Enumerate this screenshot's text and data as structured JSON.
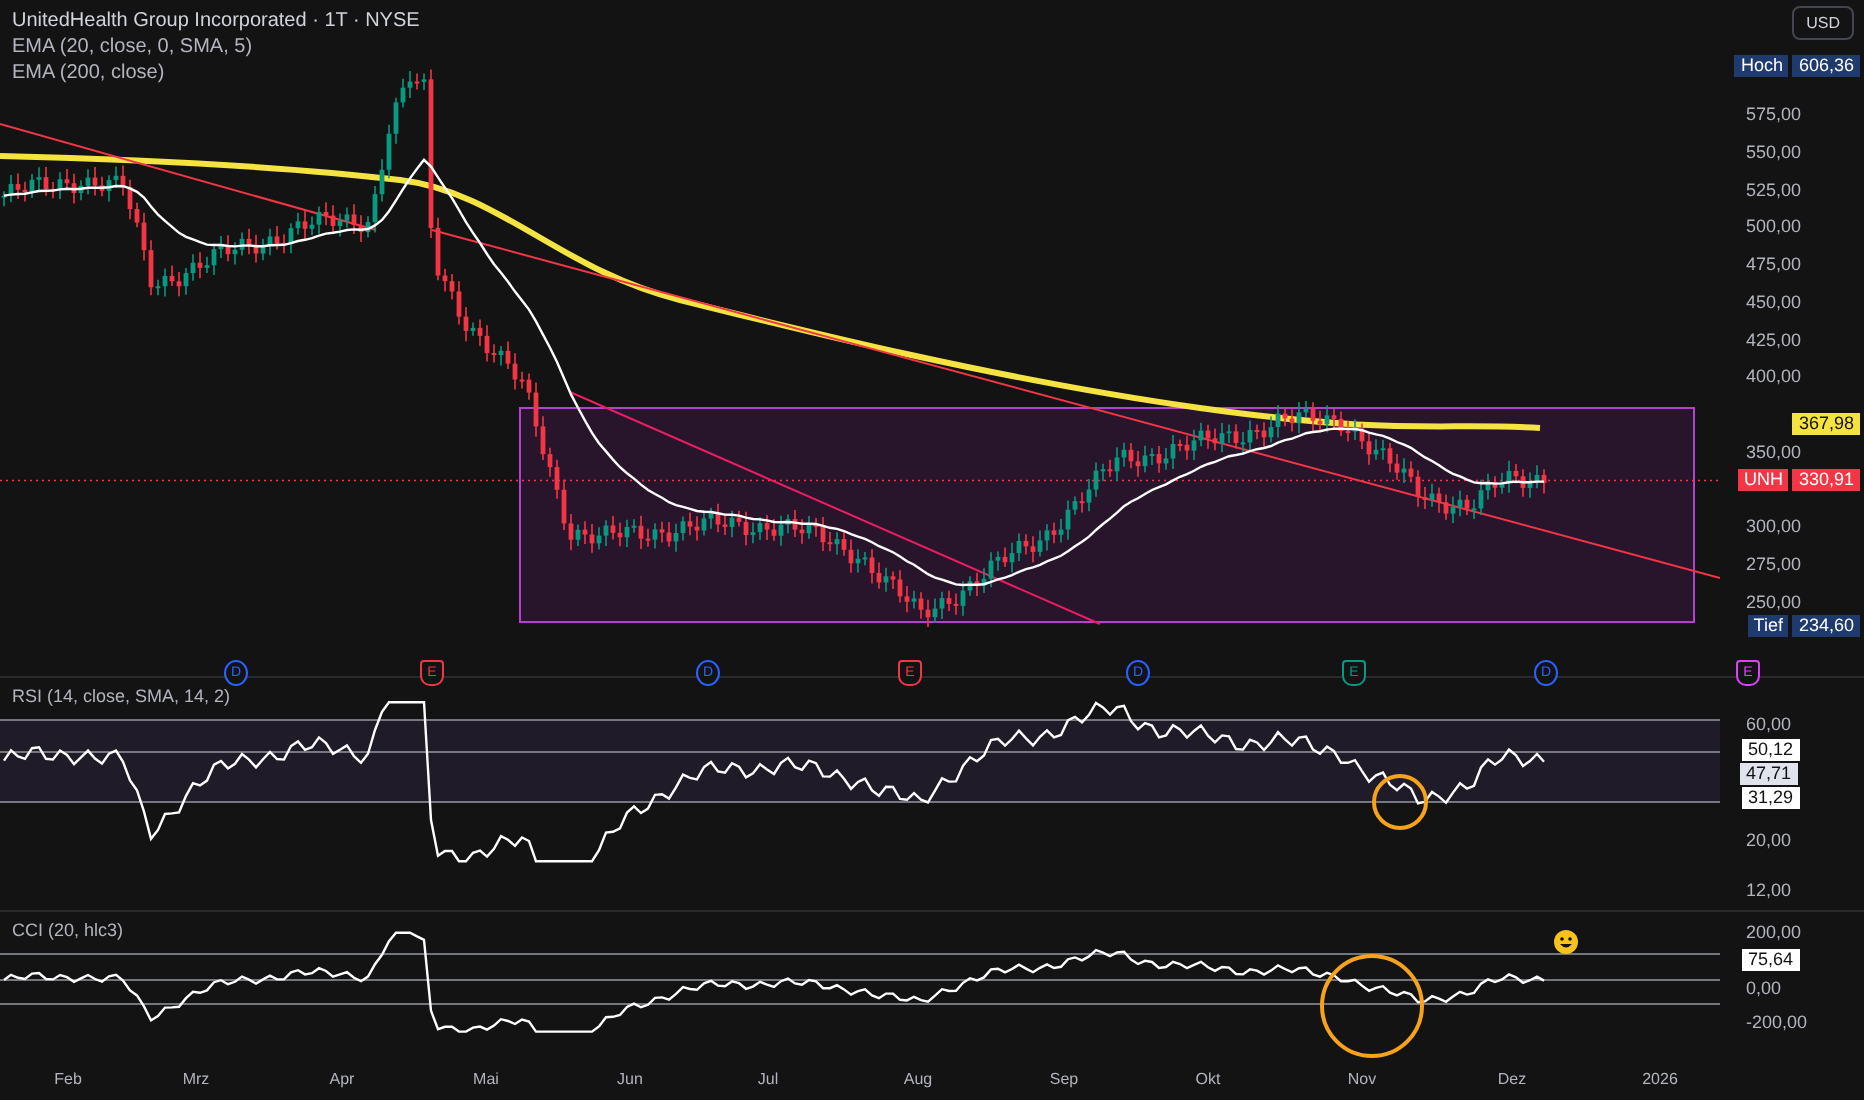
{
  "legend": {
    "title": "UnitedHealth Group Incorporated · 1T · NYSE",
    "indicators": [
      "EMA (20, close, 0, SMA, 5)",
      "EMA (200, close)"
    ]
  },
  "currency_button": "USD",
  "price_axis": {
    "ticks": [
      "575,00",
      "550,00",
      "525,00",
      "500,00",
      "475,00",
      "450,00",
      "425,00",
      "400,00",
      "350,00",
      "300,00",
      "275,00",
      "250,00"
    ],
    "labels": [
      {
        "kind": "high",
        "tag": "Hoch",
        "value": "606,36"
      },
      {
        "kind": "ema",
        "value": "367,98"
      },
      {
        "kind": "last",
        "tag": "UNH",
        "value": "330,91"
      },
      {
        "kind": "low",
        "tag": "Tief",
        "value": "234,60"
      }
    ]
  },
  "events": [
    {
      "letter": "D",
      "kind": "dividend",
      "color": "#2962ff"
    },
    {
      "letter": "E",
      "kind": "earnings",
      "color": "#f23645"
    },
    {
      "letter": "D",
      "kind": "dividend",
      "color": "#2962ff"
    },
    {
      "letter": "E",
      "kind": "earnings",
      "color": "#f23645"
    },
    {
      "letter": "D",
      "kind": "dividend",
      "color": "#2962ff"
    },
    {
      "letter": "E",
      "kind": "earnings",
      "color": "#089981"
    },
    {
      "letter": "D",
      "kind": "dividend",
      "color": "#2962ff"
    },
    {
      "letter": "E",
      "kind": "earnings",
      "color": "#e040fb"
    }
  ],
  "rsi": {
    "title": "RSI (14, close, SMA, 14, 2)",
    "ticks": [
      "60,00",
      "20,00",
      "12,00"
    ],
    "labels": [
      {
        "kind": "boxed",
        "value": "50,12"
      },
      {
        "kind": "plain",
        "value": "47,71"
      },
      {
        "kind": "boxed",
        "value": "31,29"
      }
    ]
  },
  "cci": {
    "title": "CCI (20, hlc3)",
    "ticks": [
      "200,00",
      "0,00",
      "-200,00"
    ],
    "labels": [
      {
        "kind": "boxed",
        "value": "75,64"
      }
    ]
  },
  "time_axis": [
    "Feb",
    "Mrz",
    "Apr",
    "Mai",
    "Jun",
    "Jul",
    "Aug",
    "Sep",
    "Okt",
    "Nov",
    "Dez",
    "2026"
  ]
}
